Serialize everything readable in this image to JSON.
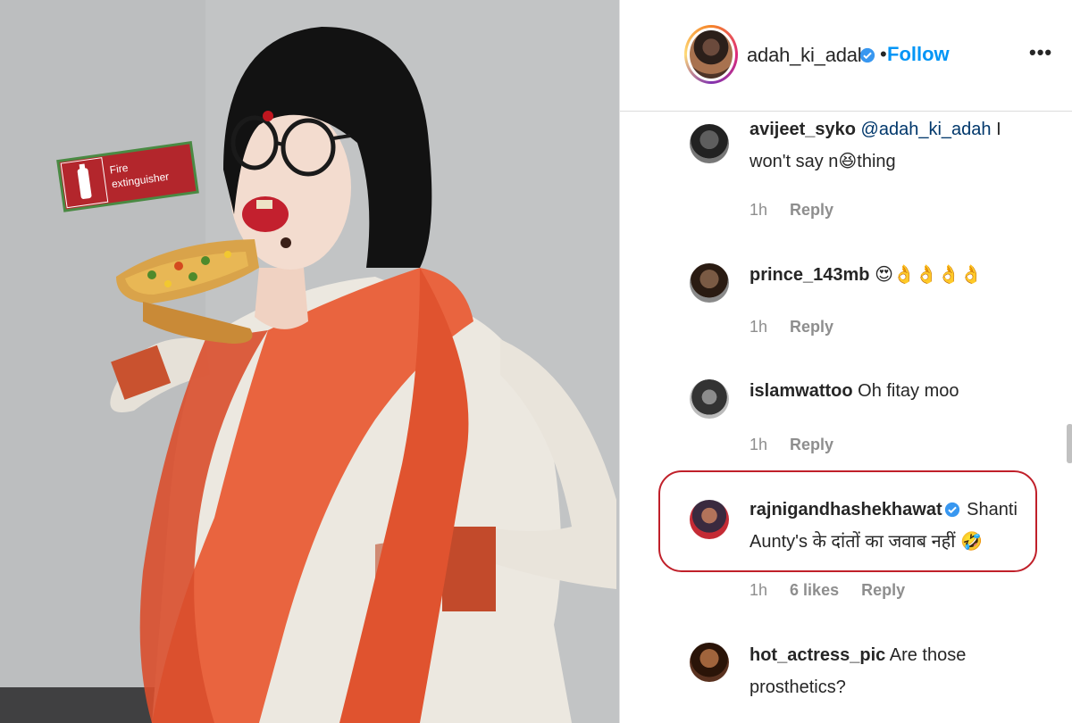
{
  "post": {
    "username": "adah_ki_adah",
    "separator": "•",
    "follow_label": "Follow",
    "more_label": "•••",
    "sign_text_line1": "Fire",
    "sign_text_line2": "extinguisher"
  },
  "colors": {
    "accent": "#0095f6",
    "text": "#262626",
    "muted": "#8e8e8e",
    "highlight_border": "#c0202a",
    "verified": "#3897f0"
  },
  "comments": [
    {
      "user": "avijeet_syko",
      "mention": "@adah_ki_adah",
      "text": " I won't say n😆thing",
      "time": "1h",
      "likes": "",
      "reply": "Reply"
    },
    {
      "user": "prince_143mb",
      "mention": "",
      "text": " 😍👌👌👌👌",
      "time": "1h",
      "likes": "",
      "reply": "Reply"
    },
    {
      "user": "islamwattoo",
      "mention": "",
      "text": " Oh fitay moo",
      "time": "1h",
      "likes": "",
      "reply": "Reply"
    },
    {
      "user": "rajnigandhashekhawat",
      "mention": "",
      "text": " Shanti Aunty's के दांतों का जवाब नहीं 🤣",
      "time": "1h",
      "likes": "6 likes",
      "reply": "Reply"
    },
    {
      "user": "hot_actress_pic",
      "mention": "",
      "text": " Are those prosthetics?",
      "time": "",
      "likes": "",
      "reply": ""
    }
  ]
}
